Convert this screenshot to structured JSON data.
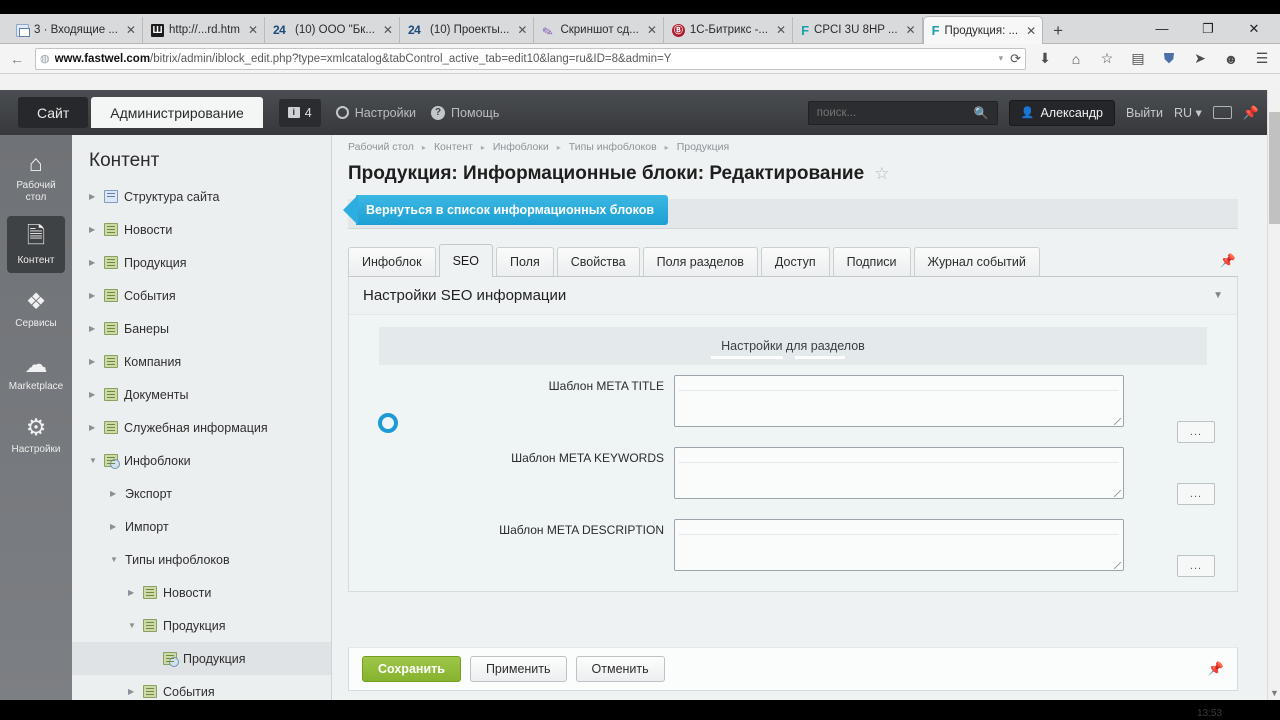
{
  "browser": {
    "tabs": [
      {
        "icon": "mail-icon",
        "label": "3 · Входящие ...",
        "active": false
      },
      {
        "icon": "w-icon",
        "label": "http://...rd.htm",
        "active": false
      },
      {
        "icon": "24-icon",
        "label": "(10) ООО \"Бк...",
        "active": false
      },
      {
        "icon": "24-icon",
        "label": "(10) Проекты...",
        "active": false
      },
      {
        "icon": "pencil-icon",
        "label": "Скриншот сд...",
        "active": false
      },
      {
        "icon": "bitrix-icon",
        "label": "1С-Битрикс -...",
        "active": false
      },
      {
        "icon": "fastwel-icon",
        "label": "CPCI 3U 8HP ...",
        "active": false
      },
      {
        "icon": "fastwel-icon",
        "label": "Продукция: ...",
        "active": true
      }
    ],
    "new_tab_label": "+",
    "window_controls": {
      "minimize": "—",
      "maximize": "❐",
      "close": "✕"
    },
    "nav": {
      "back": "←",
      "forward": "→"
    },
    "url_bold": "www.fastwel.com",
    "url_rest": "/bitrix/admin/iblock_edit.php?type=xmlcatalog&tabControl_active_tab=edit10&lang=ru&ID=8&admin=Y",
    "reload_label": "⟳",
    "toolbar_icons": [
      "download-icon",
      "home-icon",
      "star-icon",
      "library-icon",
      "shield-icon",
      "send-icon",
      "smiley-icon",
      "menu-icon"
    ]
  },
  "topbar": {
    "mode_site": "Сайт",
    "mode_admin": "Администрирование",
    "notifications_count": "4",
    "settings": "Настройки",
    "help": "Помощь",
    "search_placeholder": "поиск...",
    "user_name": "Александр",
    "logout": "Выйти",
    "language": "RU",
    "keyboard_icon": "keyboard-icon",
    "pin_icon": "pin-icon"
  },
  "rail": [
    {
      "icon": "home-icon",
      "label": "Рабочий стол",
      "active": false
    },
    {
      "icon": "document-icon",
      "label": "Контент",
      "active": true
    },
    {
      "icon": "layers-icon",
      "label": "Сервисы",
      "active": false
    },
    {
      "icon": "cloud-down-icon",
      "label": "Marketplace",
      "active": false
    },
    {
      "icon": "gear-icon",
      "label": "Настройки",
      "active": false
    }
  ],
  "tree": {
    "title": "Контент",
    "items": [
      {
        "label": "Структура сайта",
        "level": 1,
        "arrow": "right",
        "icon": "sitemap-icon",
        "selected": false
      },
      {
        "label": "Новости",
        "level": 1,
        "arrow": "right",
        "icon": "iblock-icon",
        "selected": false
      },
      {
        "label": "Продукция",
        "level": 1,
        "arrow": "right",
        "icon": "iblock-icon",
        "selected": false
      },
      {
        "label": "События",
        "level": 1,
        "arrow": "right",
        "icon": "iblock-icon",
        "selected": false
      },
      {
        "label": "Банеры",
        "level": 1,
        "arrow": "right",
        "icon": "iblock-icon",
        "selected": false
      },
      {
        "label": "Компания",
        "level": 1,
        "arrow": "right",
        "icon": "iblock-icon",
        "selected": false
      },
      {
        "label": "Документы",
        "level": 1,
        "arrow": "right",
        "icon": "iblock-icon",
        "selected": false
      },
      {
        "label": "Служебная информация",
        "level": 1,
        "arrow": "right",
        "icon": "iblock-icon",
        "selected": false
      },
      {
        "label": "Инфоблоки",
        "level": 1,
        "arrow": "down",
        "icon": "iblock-gear-icon",
        "selected": false
      },
      {
        "label": "Экспорт",
        "level": 2,
        "arrow": "right",
        "icon": "none",
        "selected": false
      },
      {
        "label": "Импорт",
        "level": 2,
        "arrow": "right",
        "icon": "none",
        "selected": false
      },
      {
        "label": "Типы инфоблоков",
        "level": 2,
        "arrow": "down",
        "icon": "none",
        "selected": false
      },
      {
        "label": "Новости",
        "level": 3,
        "arrow": "right",
        "icon": "iblock-icon",
        "selected": false
      },
      {
        "label": "Продукция",
        "level": 3,
        "arrow": "down",
        "icon": "iblock-icon",
        "selected": false
      },
      {
        "label": "Продукция",
        "level": 4,
        "arrow": "dot",
        "icon": "iblock-gear-icon",
        "selected": true
      },
      {
        "label": "События",
        "level": 3,
        "arrow": "right",
        "icon": "iblock-icon",
        "selected": false
      }
    ]
  },
  "main": {
    "breadcrumb": [
      "Рабочий стол",
      "Контент",
      "Инфоблоки",
      "Типы инфоблоков",
      "Продукция"
    ],
    "breadcrumb_sep": "▸",
    "page_title": "Продукция: Информационные блоки: Редактирование",
    "favorite_star": "☆",
    "back_button": "Вернуться в список информационных блоков",
    "tabs": [
      {
        "label": "Инфоблок",
        "active": false
      },
      {
        "label": "SEO",
        "active": true
      },
      {
        "label": "Поля",
        "active": false
      },
      {
        "label": "Свойства",
        "active": false
      },
      {
        "label": "Поля разделов",
        "active": false
      },
      {
        "label": "Доступ",
        "active": false
      },
      {
        "label": "Подписи",
        "active": false
      },
      {
        "label": "Журнал событий",
        "active": false
      }
    ],
    "tabs_pin_icon": "pin-icon",
    "section": {
      "title": "Настройки SEO информации",
      "collapse_icon": "chevron-down-icon",
      "subheader": "Настройки для разделов",
      "fields": [
        {
          "label": "Шаблон META TITLE",
          "value": "",
          "button": "...",
          "button_name": "meta-title-picker-button"
        },
        {
          "label": "Шаблон META KEYWORDS",
          "value": "",
          "button": "...",
          "button_name": "meta-keywords-picker-button"
        },
        {
          "label": "Шаблон META DESCRIPTION",
          "value": "",
          "button": "...",
          "button_name": "meta-description-picker-button"
        }
      ]
    },
    "actions": {
      "save": "Сохранить",
      "apply": "Применить",
      "cancel": "Отменить",
      "pin_icon": "pin-icon"
    },
    "loading_indicator": "spinner"
  },
  "taskbar": {
    "clock": "13:53"
  },
  "colors": {
    "accent_blue": "#1ca0d4",
    "save_green": "#86b32e",
    "topbar_dark": "#3f4246",
    "rail_gray": "#7c7f83",
    "app_bg": "#eef2f3"
  }
}
